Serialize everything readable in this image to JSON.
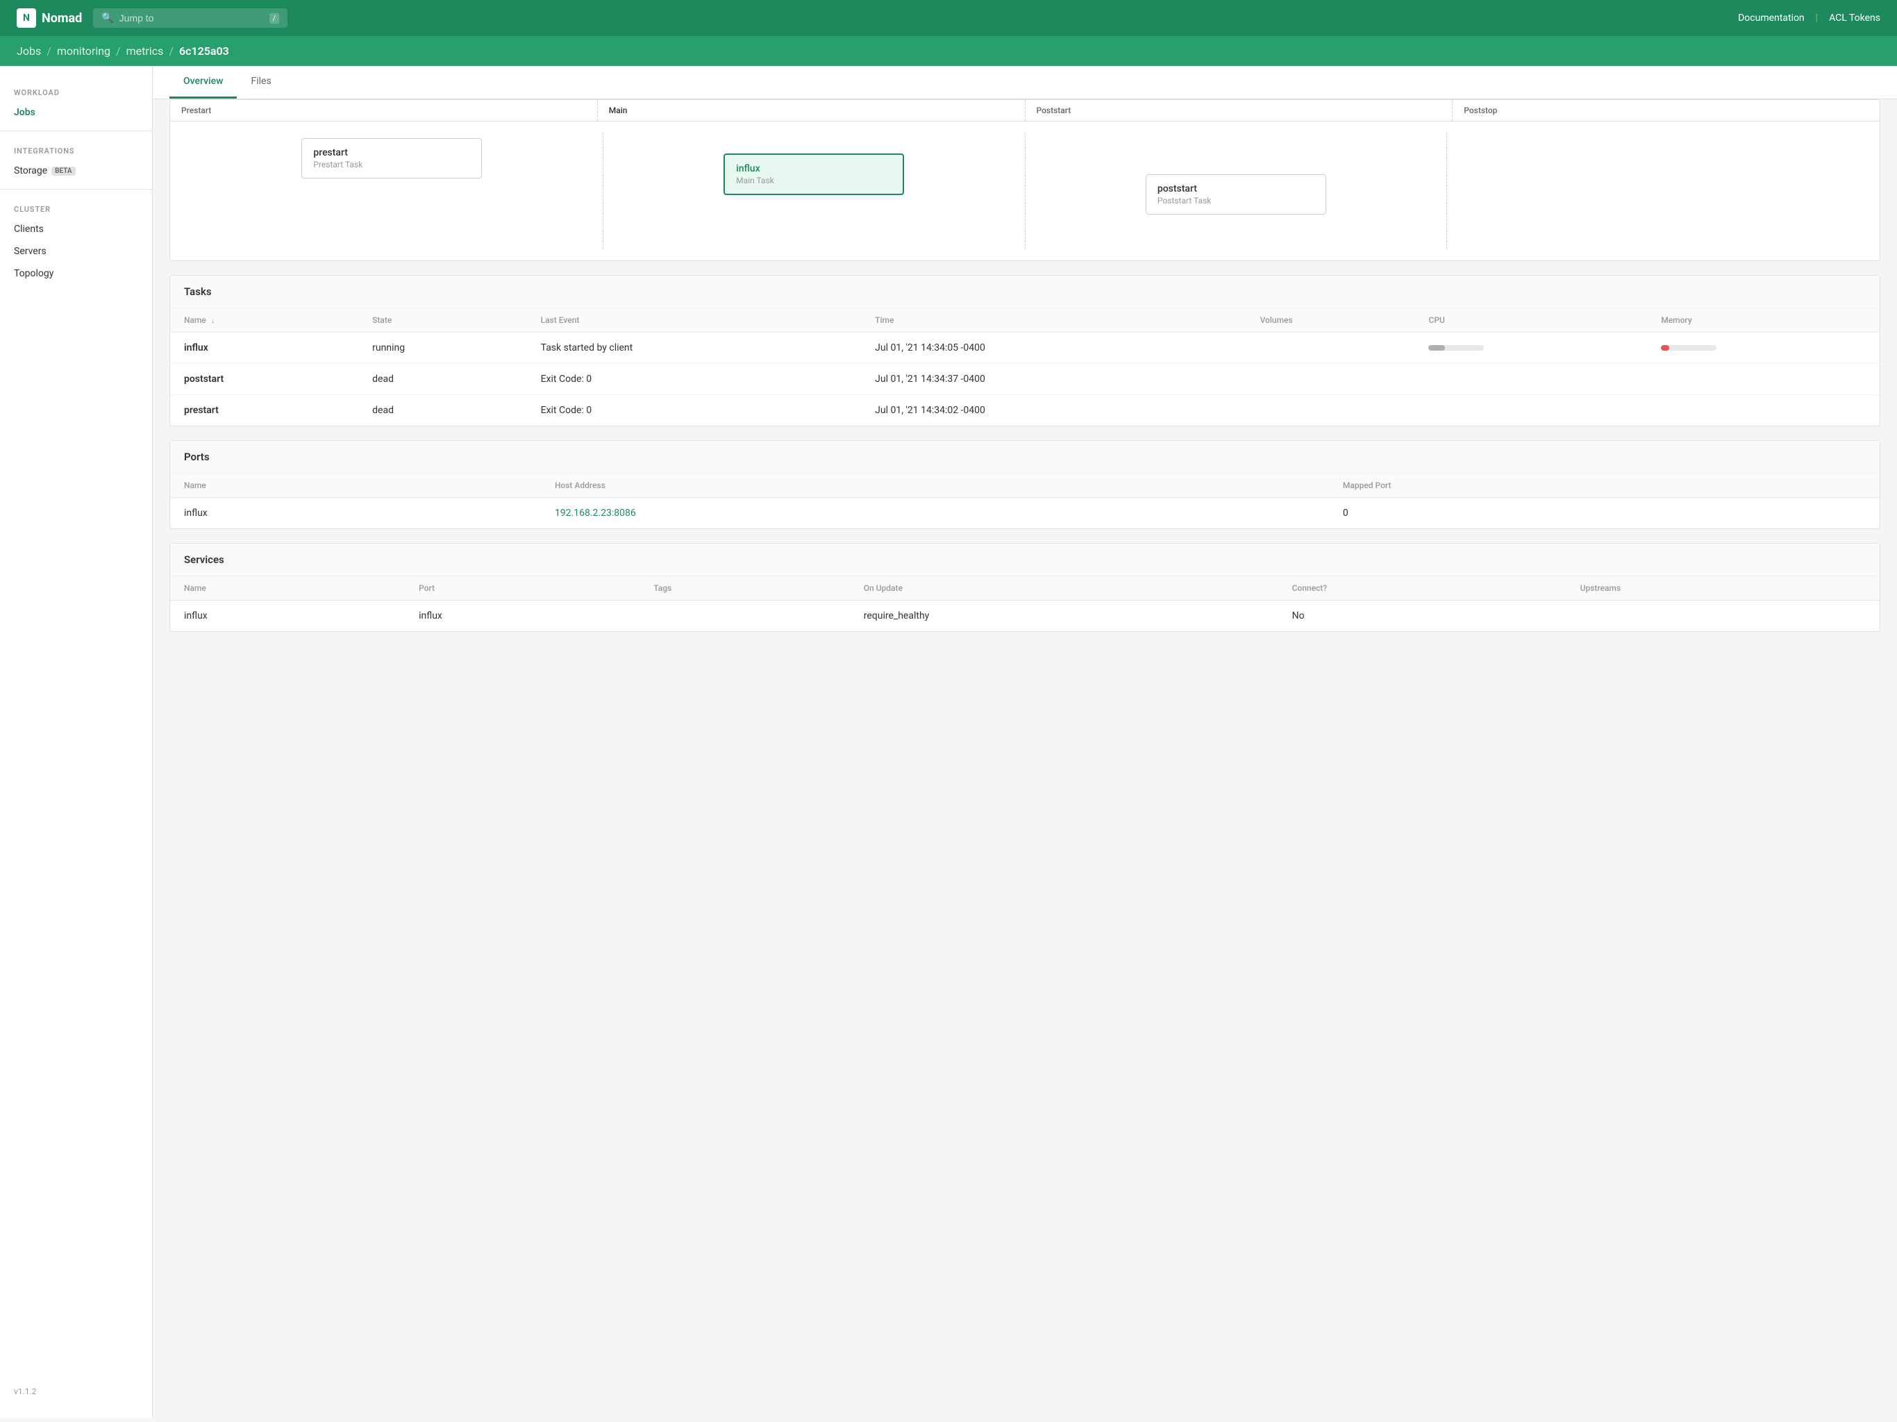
{
  "nav": {
    "logo_text": "Nomad",
    "search_placeholder": "Jump to",
    "search_shortcut": "/",
    "links": [
      "Documentation",
      "ACL Tokens"
    ]
  },
  "breadcrumb": {
    "items": [
      "Jobs",
      "monitoring",
      "metrics",
      "6c125a03"
    ]
  },
  "sidebar": {
    "sections": [
      {
        "label": "WORKLOAD",
        "items": [
          {
            "id": "jobs",
            "label": "Jobs",
            "active": true,
            "beta": false
          }
        ]
      },
      {
        "label": "INTEGRATIONS",
        "items": [
          {
            "id": "storage",
            "label": "Storage",
            "active": false,
            "beta": true
          }
        ]
      },
      {
        "label": "CLUSTER",
        "items": [
          {
            "id": "clients",
            "label": "Clients",
            "active": false,
            "beta": false
          },
          {
            "id": "servers",
            "label": "Servers",
            "active": false,
            "beta": false
          },
          {
            "id": "topology",
            "label": "Topology",
            "active": false,
            "beta": false
          }
        ]
      }
    ],
    "version": "v1.1.2"
  },
  "tabs": [
    {
      "id": "overview",
      "label": "Overview",
      "active": true
    },
    {
      "id": "files",
      "label": "Files",
      "active": false
    }
  ],
  "lifecycle": {
    "columns": [
      "Prestart",
      "Main",
      "Poststart",
      "Poststop"
    ],
    "tasks": [
      {
        "col": 0,
        "name": "prestart",
        "label": "Prestart Task",
        "highlighted": false
      },
      {
        "col": 1,
        "name": "influx",
        "label": "Main Task",
        "highlighted": true
      },
      {
        "col": 2,
        "name": "poststart",
        "label": "Poststart Task",
        "highlighted": false
      }
    ]
  },
  "tasks_section": {
    "title": "Tasks",
    "columns": [
      "Name",
      "State",
      "Last Event",
      "Time",
      "Volumes",
      "CPU",
      "Memory"
    ],
    "rows": [
      {
        "name": "influx",
        "state": "running",
        "last_event": "Task started by client",
        "time": "Jul 01, '21 14:34:05 -0400",
        "volumes": "",
        "has_bars": true
      },
      {
        "name": "poststart",
        "state": "dead",
        "last_event": "Exit Code: 0",
        "time": "Jul 01, '21 14:34:37 -0400",
        "volumes": "",
        "has_bars": false
      },
      {
        "name": "prestart",
        "state": "dead",
        "last_event": "Exit Code: 0",
        "time": "Jul 01, '21 14:34:02 -0400",
        "volumes": "",
        "has_bars": false
      }
    ]
  },
  "ports_section": {
    "title": "Ports",
    "columns": [
      "Name",
      "Host Address",
      "Mapped Port"
    ],
    "rows": [
      {
        "name": "influx",
        "host_address": "192.168.2.23:8086",
        "mapped_port": "0"
      }
    ]
  },
  "services_section": {
    "title": "Services",
    "columns": [
      "Name",
      "Port",
      "Tags",
      "On Update",
      "Connect?",
      "Upstreams"
    ],
    "rows": [
      {
        "name": "influx",
        "port": "influx",
        "tags": "",
        "on_update": "require_healthy",
        "connect": "No",
        "upstreams": ""
      }
    ]
  }
}
